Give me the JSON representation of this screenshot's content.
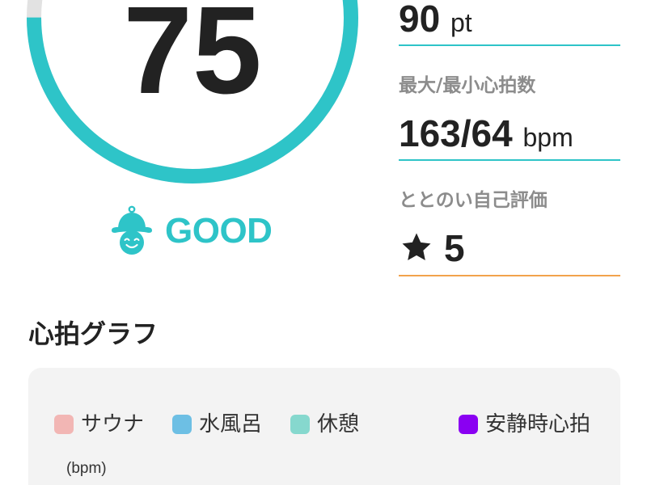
{
  "score": {
    "value": "75",
    "ring_fill": 0.75,
    "status_label": "GOOD",
    "mascot_icon": "sauna-hat-mascot-icon"
  },
  "stats": {
    "points": {
      "value": "90",
      "unit": "pt"
    },
    "heart_rate": {
      "label": "最大/最小心拍数",
      "value": "163/64",
      "unit": "bpm"
    },
    "self_rating": {
      "label": "ととのい自己評価",
      "icon": "star-icon",
      "value": "5"
    }
  },
  "heart_graph": {
    "title": "心拍グラフ",
    "legend": [
      {
        "label": "サウナ",
        "color": "#F2B6B4"
      },
      {
        "label": "水風呂",
        "color": "#6DBFE4"
      },
      {
        "label": "休憩",
        "color": "#86D8CE"
      },
      {
        "label": "安静時心拍",
        "color": "#8A00F2"
      }
    ],
    "y_unit": "(bpm)"
  },
  "colors": {
    "accent": "#2EC4C8",
    "ring_track": "#E2E2E2",
    "rating_underline": "#F2A24C",
    "card_background": "#F3F3F3",
    "text": "#222222"
  }
}
